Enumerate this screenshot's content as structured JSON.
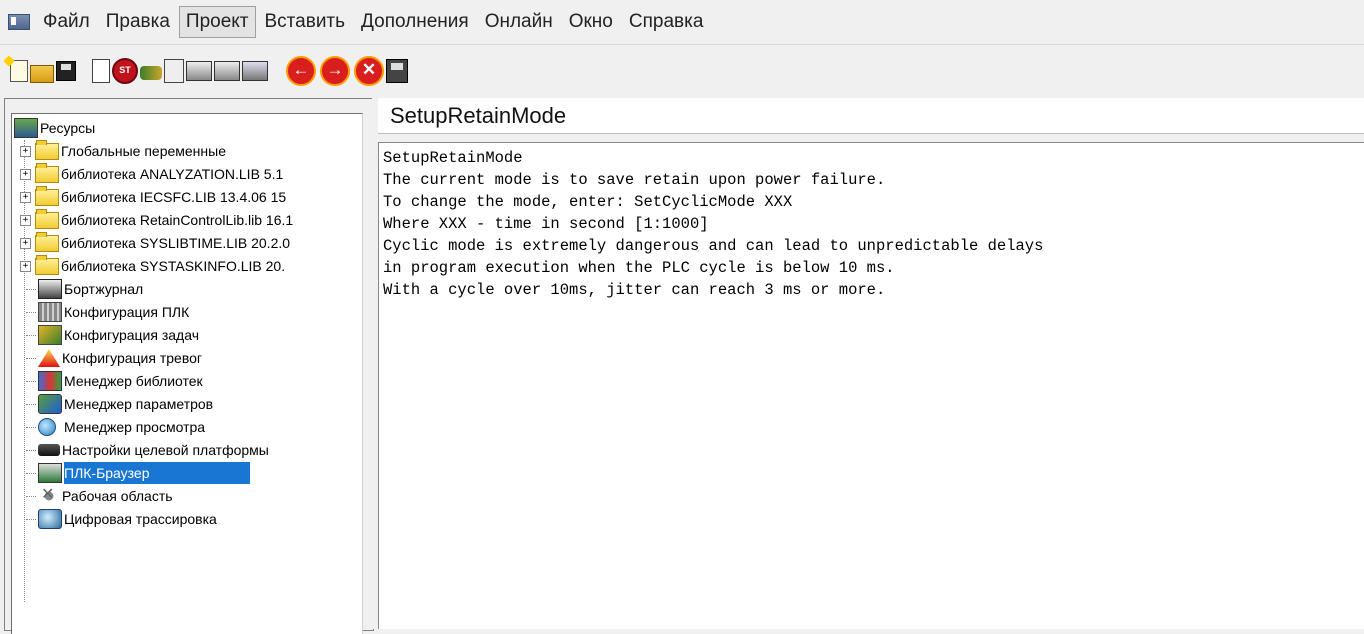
{
  "menu": {
    "items": [
      "Файл",
      "Правка",
      "Проект",
      "Вставить",
      "Дополнения",
      "Онлайн",
      "Окно",
      "Справка"
    ],
    "active_index": 2
  },
  "toolbar": {
    "icons": [
      "new-icon",
      "open-icon",
      "save-icon",
      "list-icon",
      "stop-icon",
      "connect-icon",
      "docs-icon",
      "printer-icon",
      "printer-setup-icon",
      "search-icon",
      "back-icon",
      "forward-icon",
      "close-icon",
      "save-all-icon"
    ]
  },
  "tree": {
    "root": "Ресурсы",
    "items": [
      {
        "label": "Глобальные переменные",
        "type": "folder",
        "expandable": true
      },
      {
        "label": "библиотека ANALYZATION.LIB 5.1",
        "type": "folder",
        "expandable": true
      },
      {
        "label": "библиотека IECSFC.LIB 13.4.06 15",
        "type": "folder",
        "expandable": true
      },
      {
        "label": "библиотека RetainControlLib.lib 16.1",
        "type": "folder",
        "expandable": true
      },
      {
        "label": "библиотека SYSLIBTIME.LIB 20.2.0",
        "type": "folder",
        "expandable": true
      },
      {
        "label": "библиотека SYSTASKINFO.LIB 20.",
        "type": "folder",
        "expandable": true
      },
      {
        "label": "Бортжурнал",
        "type": "log"
      },
      {
        "label": "Конфигурация ПЛК",
        "type": "plc"
      },
      {
        "label": "Конфигурация задач",
        "type": "task"
      },
      {
        "label": "Конфигурация тревог",
        "type": "alarm"
      },
      {
        "label": "Менеджер библиотек",
        "type": "lib"
      },
      {
        "label": "Менеджер параметров",
        "type": "param"
      },
      {
        "label": "Менеджер просмотра",
        "type": "watch"
      },
      {
        "label": "Настройки целевой платформы",
        "type": "target"
      },
      {
        "label": "ПЛК-Браузер",
        "type": "browser",
        "selected": true
      },
      {
        "label": "Рабочая область",
        "type": "work"
      },
      {
        "label": "Цифровая трассировка",
        "type": "trace"
      }
    ]
  },
  "content": {
    "title": "SetupRetainMode",
    "lines": [
      "SetupRetainMode",
      "The current mode is to save retain upon power failure.",
      "To change the mode, enter: SetCyclicMode XXX",
      "Where XXX - time in second [1:1000]",
      "Cyclic mode is extremely dangerous and can lead to unpredictable delays",
      "in program execution when the PLC cycle is below 10 ms.",
      "With a cycle over 10ms, jitter can reach 3 ms or more."
    ]
  }
}
